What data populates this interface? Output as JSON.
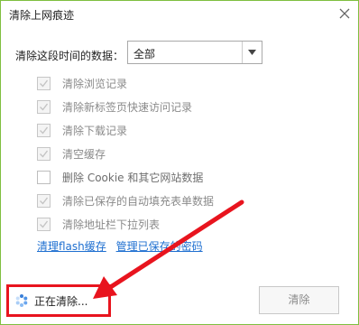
{
  "dialog": {
    "title": "清除上网痕迹",
    "close_icon": "close-icon"
  },
  "range": {
    "label": "清除这段时间的数据：",
    "selected": "全部"
  },
  "options": [
    {
      "label": "清除浏览记录",
      "checked": true,
      "enabled": false
    },
    {
      "label": "清除新标签页快速访问记录",
      "checked": true,
      "enabled": false
    },
    {
      "label": "清除下载记录",
      "checked": true,
      "enabled": false
    },
    {
      "label": "清空缓存",
      "checked": true,
      "enabled": false
    },
    {
      "label": "删除 Cookie 和其它网站数据",
      "checked": false,
      "enabled": true
    },
    {
      "label": "清除已保存的自动填充表单数据",
      "checked": true,
      "enabled": false
    },
    {
      "label": "清除地址栏下拉列表",
      "checked": true,
      "enabled": false
    }
  ],
  "links": {
    "flash": "清理flash缓存",
    "passwords": "管理已保存的密码"
  },
  "status": {
    "text": "正在清除...",
    "icon": "spinner-icon"
  },
  "buttons": {
    "clear": "清除"
  },
  "colors": {
    "border": "#7fbf3f",
    "annotation": "#e8141e",
    "link": "#1e6fd0"
  }
}
